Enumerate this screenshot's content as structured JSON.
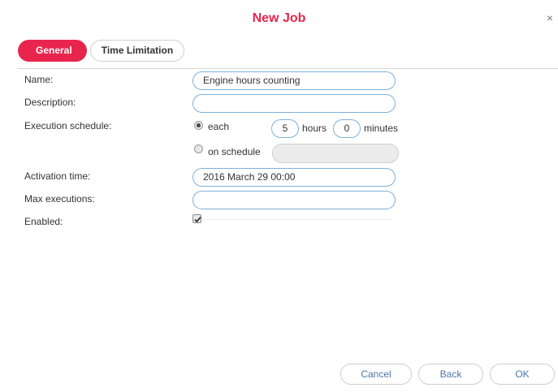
{
  "dialog": {
    "title": "New Job",
    "close_glyph": "×",
    "accent_color": "#e8264d"
  },
  "tabs": [
    {
      "label": "General",
      "active": true
    },
    {
      "label": "Time Limitation",
      "active": false
    }
  ],
  "form": {
    "name_label": "Name:",
    "name_value": "Engine hours counting",
    "description_label": "Description:",
    "description_value": "",
    "schedule_label": "Execution schedule:",
    "each_label": "each",
    "each_selected": true,
    "hours_value": "5",
    "hours_label": "hours",
    "minutes_value": "0",
    "minutes_label": "minutes",
    "on_schedule_label": "on schedule",
    "on_schedule_selected": false,
    "on_schedule_value": "",
    "activation_label": "Activation time:",
    "activation_value": "2016 March 29 00:00",
    "max_exec_label": "Max executions:",
    "max_exec_value": "",
    "enabled_label": "Enabled:",
    "enabled_checked": true
  },
  "footer": {
    "cancel_label": "Cancel",
    "back_label": "Back",
    "ok_label": "OK"
  }
}
